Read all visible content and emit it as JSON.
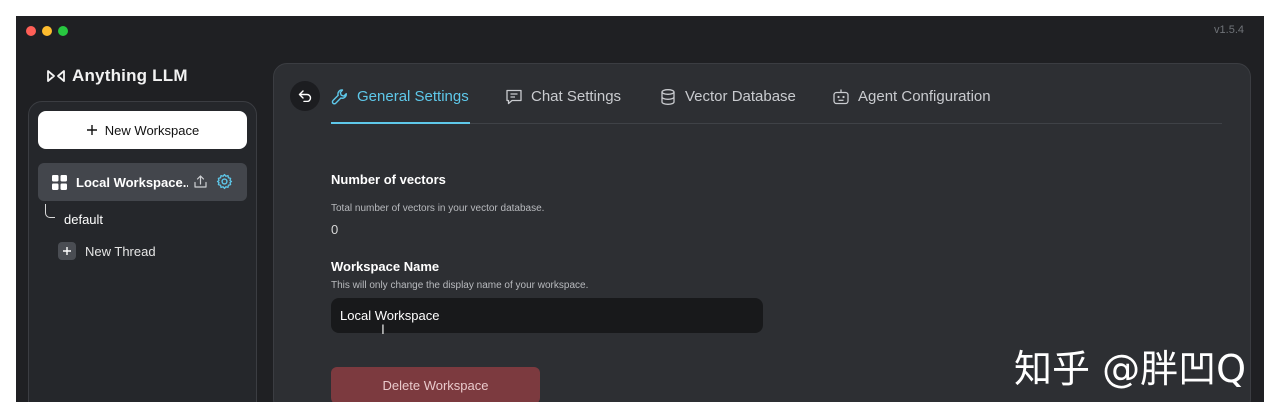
{
  "window": {
    "version": "v1.5.4"
  },
  "brand": {
    "name": "Anything LLM"
  },
  "sidebar": {
    "new_workspace_label": "New Workspace",
    "workspace": {
      "label": "Local Workspace..."
    },
    "thread_default": "default",
    "new_thread_label": "New Thread"
  },
  "tabs": [
    {
      "label": "General Settings",
      "icon": "wrench-icon",
      "active": true
    },
    {
      "label": "Chat Settings",
      "icon": "chat-icon",
      "active": false
    },
    {
      "label": "Vector Database",
      "icon": "database-icon",
      "active": false
    },
    {
      "label": "Agent Configuration",
      "icon": "robot-icon",
      "active": false
    }
  ],
  "settings": {
    "vectors_title": "Number of vectors",
    "vectors_desc": "Total number of vectors in your vector database.",
    "vectors_value": "0",
    "name_title": "Workspace Name",
    "name_desc": "This will only change the display name of your workspace.",
    "name_value": "Local Workspace",
    "delete_label": "Delete Workspace"
  },
  "watermark": "知乎 @胖凹Q",
  "colors": {
    "accent": "#5ec8ea",
    "danger": "#7c3a3f",
    "background": "#1f2023",
    "panel": "#2d2f33"
  }
}
